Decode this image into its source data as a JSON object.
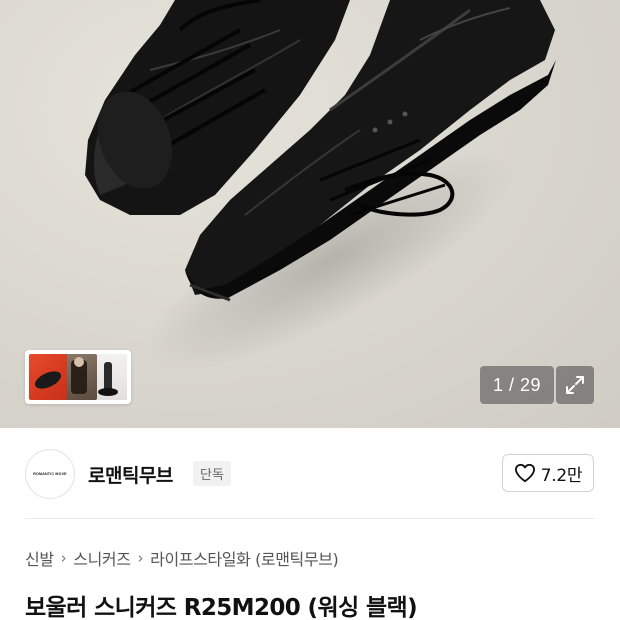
{
  "gallery": {
    "counter": "1 / 29",
    "thumbnail_count": 3
  },
  "brand": {
    "logo_text": "ROMANTIC MOVE",
    "name": "로맨틱무브",
    "badge": "단독"
  },
  "like": {
    "count": "7.2만"
  },
  "breadcrumb": {
    "items": [
      "신발",
      "스니커즈",
      "라이프스타일화 (로맨틱무브)"
    ]
  },
  "product": {
    "title": "보울러 스니커즈 R25M200 (워싱 블랙)"
  },
  "colors": {
    "accent_red": "#e84a2a",
    "overlay": "#464646",
    "text": "#111111"
  }
}
